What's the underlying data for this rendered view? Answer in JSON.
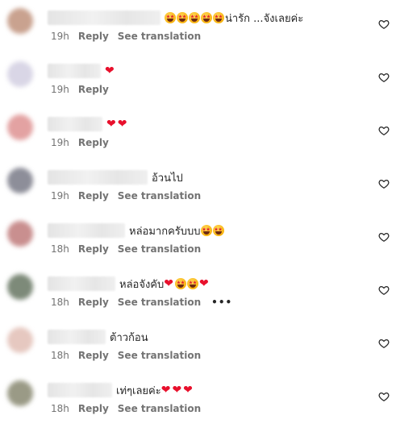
{
  "comments": [
    {
      "text": "น่ารัก ...จังเลยค่ะ",
      "emojis_before": [
        "star-struck",
        "star-struck",
        "star-struck",
        "star-struck",
        "star-struck"
      ],
      "emojis_after": [],
      "time": "19h",
      "reply": "Reply",
      "translation": "See translation"
    },
    {
      "text": "",
      "emojis_before": [],
      "emojis_after": [
        "red-heart"
      ],
      "time": "19h",
      "reply": "Reply",
      "translation": ""
    },
    {
      "text": "",
      "emojis_before": [],
      "emojis_after": [
        "red-heart",
        "red-heart"
      ],
      "time": "19h",
      "reply": "Reply",
      "translation": ""
    },
    {
      "text": "อ้วนไป",
      "emojis_before": [],
      "emojis_after": [],
      "time": "19h",
      "reply": "Reply",
      "translation": "See translation"
    },
    {
      "text": "หล่อมากครับบบ",
      "emojis_before": [],
      "emojis_after": [
        "star-struck",
        "star-struck"
      ],
      "time": "18h",
      "reply": "Reply",
      "translation": "See translation"
    },
    {
      "text": "หล่อจังคับ",
      "emojis_before": [],
      "emojis_after": [
        "red-heart",
        "star-struck",
        "star-struck",
        "red-heart"
      ],
      "time": "18h",
      "reply": "Reply",
      "translation": "See translation",
      "more": "•••"
    },
    {
      "text": "ต้าวก้อน",
      "emojis_before": [],
      "emojis_after": [],
      "time": "18h",
      "reply": "Reply",
      "translation": "See translation"
    },
    {
      "text": "เท่ๆเลยค่ะ",
      "emojis_before": [],
      "emojis_after": [
        "red-heart",
        "red-heart",
        "red-heart"
      ],
      "time": "18h",
      "reply": "Reply",
      "translation": "See translation"
    }
  ],
  "colors": {
    "text": "#262626",
    "meta": "#737373",
    "heart": "#e8102c",
    "avatar_tints": [
      "#c9a28f",
      "#d9d6e6",
      "#e3a2a2",
      "#8d8e99",
      "#c98f8f",
      "#7d8a79",
      "#e6c8c0",
      "#9a9a86"
    ]
  },
  "icons": {
    "like": "heart-outline-icon"
  }
}
